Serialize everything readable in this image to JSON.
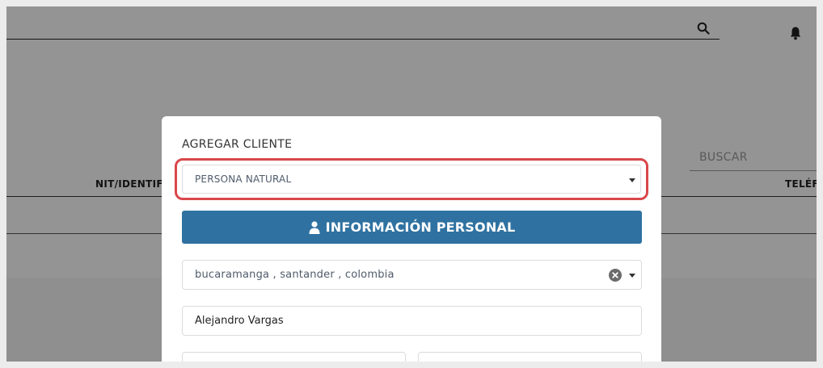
{
  "background": {
    "search_label": "BUSCAR",
    "columns": [
      "NIT/IDENTIFIC",
      "TELÉFO"
    ]
  },
  "modal": {
    "title": "AGREGAR CLIENTE",
    "client_type": {
      "value": "PERSONA NATURAL"
    },
    "section_button": {
      "icon": "user-icon",
      "label": "INFORMACIÓN PERSONAL"
    },
    "city_select": {
      "value": "bucaramanga , santander , colombia"
    },
    "name_field": {
      "value": "Alejandro Vargas"
    }
  },
  "colors": {
    "accent": "#2f72a1",
    "highlight": "#d9474a"
  },
  "icons": {
    "search": "search-icon",
    "notifications": "bell-icon",
    "clear": "clear-icon",
    "dropdown": "chevron-down-icon"
  }
}
